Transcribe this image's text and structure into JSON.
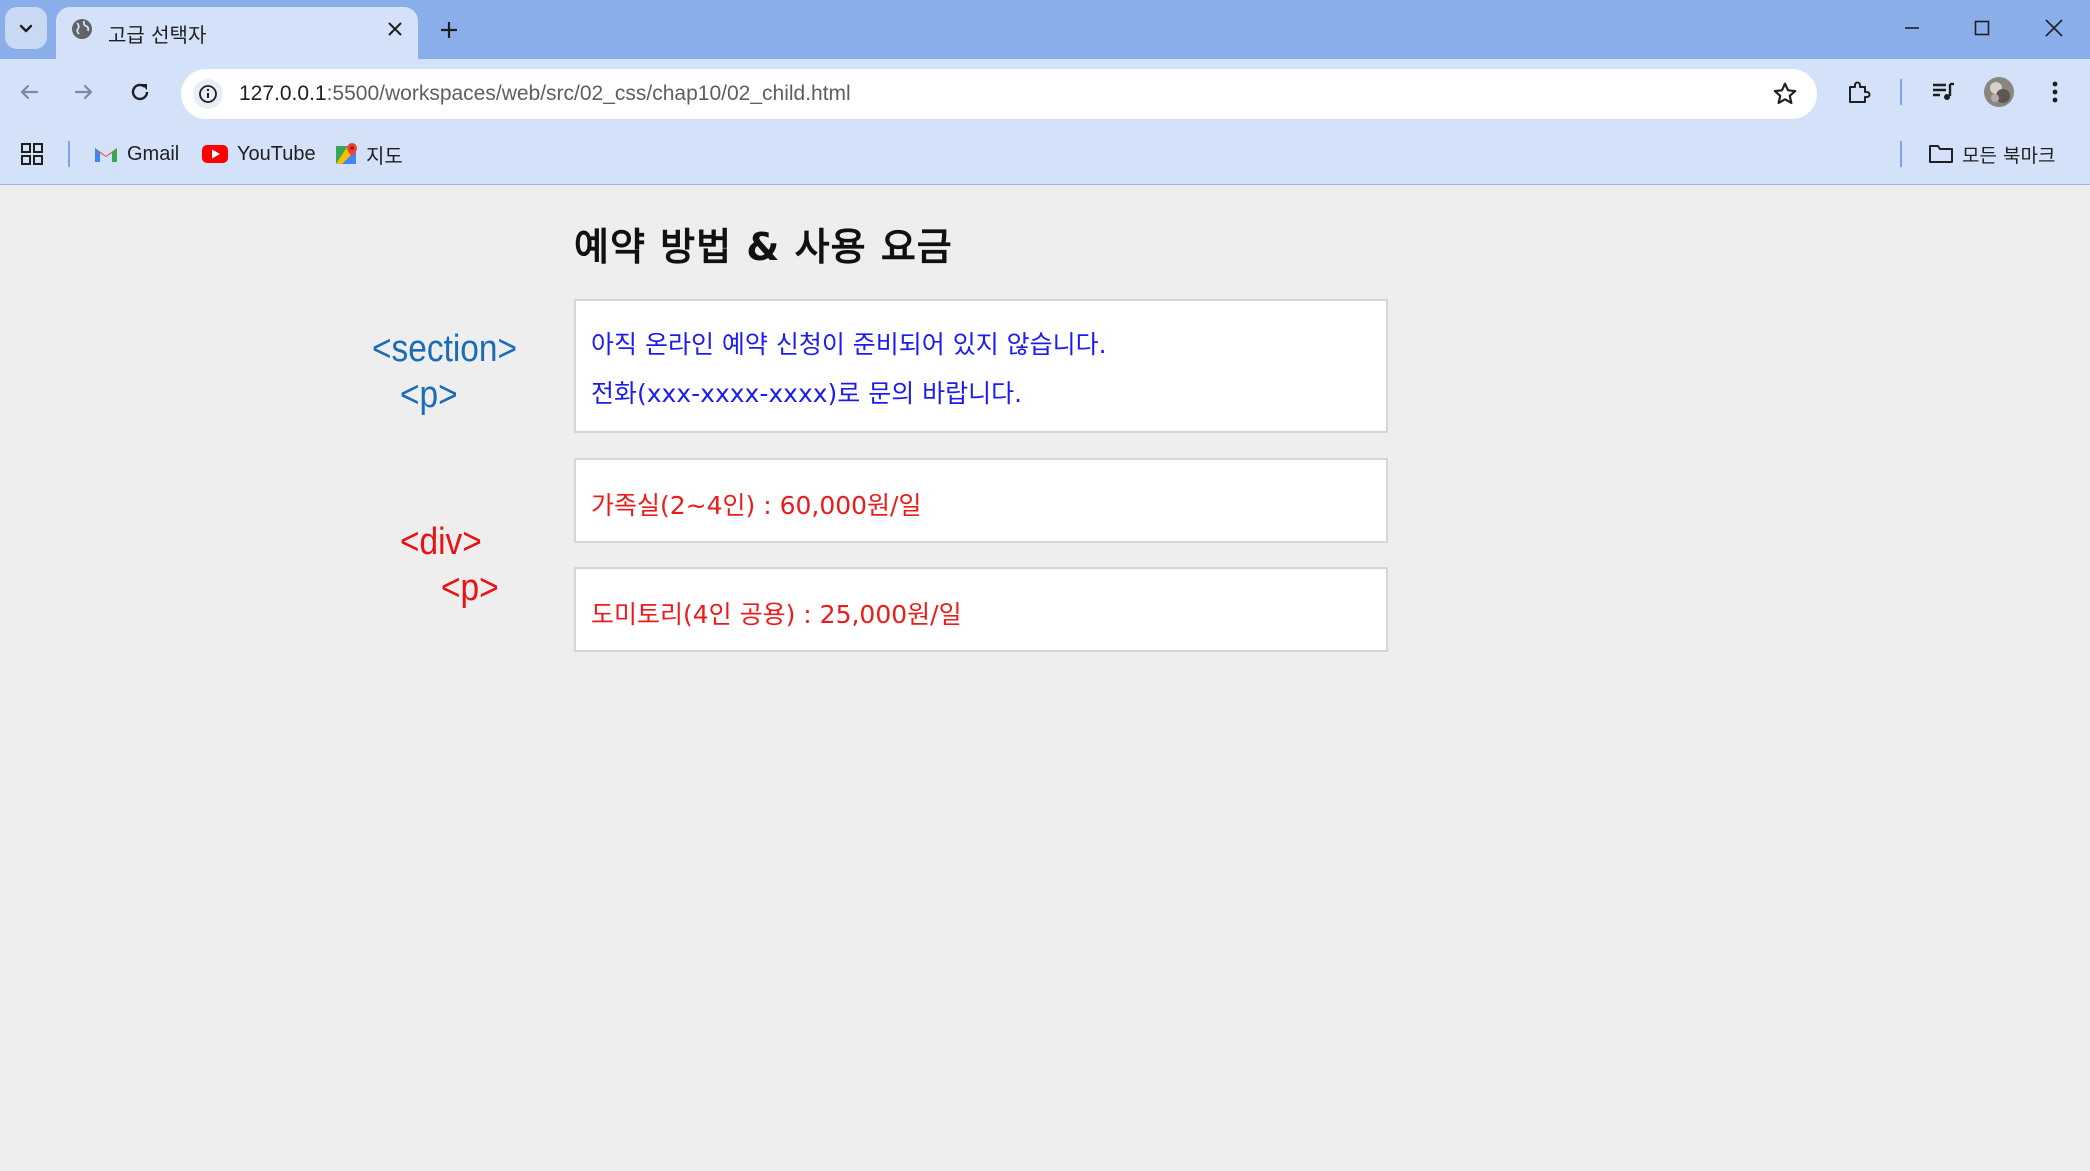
{
  "browser": {
    "tab": {
      "title": "고급 선택자"
    },
    "address": {
      "host": "127.0.0.1",
      "path": ":5500/workspaces/web/src/02_css/chap10/02_child.html"
    },
    "bookmarks": [
      {
        "label": "Gmail",
        "icon": "gmail-icon"
      },
      {
        "label": "YouTube",
        "icon": "youtube-icon"
      },
      {
        "label": "지도",
        "icon": "maps-icon"
      }
    ],
    "all_bookmarks": "모든 북마크"
  },
  "page": {
    "heading": "예약 방법 & 사용 요금",
    "section_lines": [
      "아직 온라인 예약 신청이 준비되어 있지 않습니다.",
      "전화(xxx-xxxx-xxxx)로 문의 바랍니다."
    ],
    "div_items": [
      "가족실(2~4인) : 60,000원/일",
      "도미토리(4인 공용) : 25,000원/일"
    ]
  },
  "annotations": {
    "section_tag": "<section>",
    "section_p_tag": "<p>",
    "div_tag": "<div>",
    "div_p_tag": "<p>"
  },
  "colors": {
    "section_text": "#1c1cf0",
    "div_text": "#ee1a1a",
    "annotation_blue": "#1a6cb8",
    "annotation_red": "#ea1212"
  }
}
